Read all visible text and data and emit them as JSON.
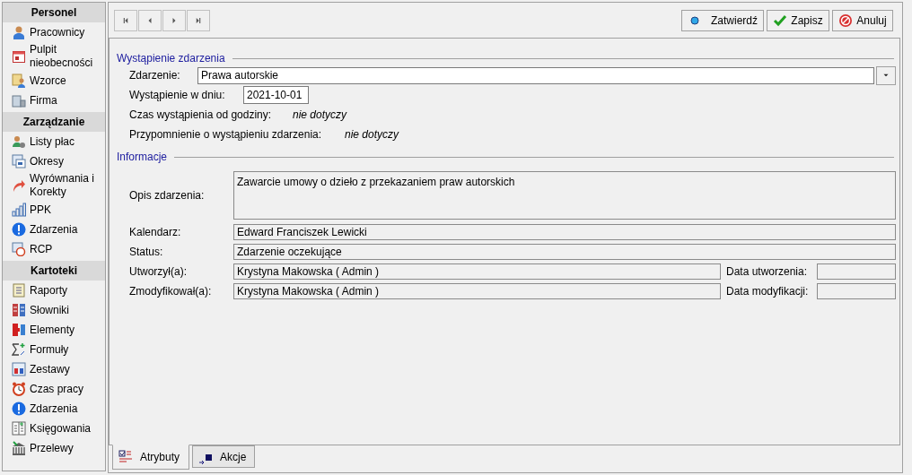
{
  "sidebar": {
    "sections": [
      {
        "title": "Personel",
        "items": [
          {
            "label": "Pracownicy"
          },
          {
            "label": "Pulpit nieobecności"
          },
          {
            "label": "Wzorce"
          },
          {
            "label": "Firma"
          }
        ]
      },
      {
        "title": "Zarządzanie",
        "items": [
          {
            "label": "Listy płac"
          },
          {
            "label": "Okresy"
          },
          {
            "label": "Wyrównania i Korekty"
          },
          {
            "label": "PPK"
          },
          {
            "label": "Zdarzenia"
          },
          {
            "label": "RCP"
          }
        ]
      },
      {
        "title": "Kartoteki",
        "items": [
          {
            "label": "Raporty"
          },
          {
            "label": "Słowniki"
          },
          {
            "label": "Elementy"
          },
          {
            "label": "Formuły"
          },
          {
            "label": "Zestawy"
          },
          {
            "label": "Czas pracy"
          },
          {
            "label": "Zdarzenia"
          },
          {
            "label": "Księgowania"
          },
          {
            "label": "Przelewy"
          }
        ]
      }
    ]
  },
  "toolbar": {
    "buttons": [
      {
        "label": "Zatwierdź"
      },
      {
        "label": "Zapisz"
      },
      {
        "label": "Anuluj"
      }
    ]
  },
  "occurrence": {
    "heading": "Wystąpienie zdarzenia",
    "event_label": "Zdarzenie:",
    "event_value": "Prawa autorskie",
    "date_label": "Wystąpienie w dniu:",
    "date_value": "2021-10-01",
    "time_label": "Czas wystąpienia od godziny:",
    "time_value": "nie dotyczy",
    "reminder_label": "Przypomnienie o wystąpieniu zdarzenia:",
    "reminder_value": "nie dotyczy"
  },
  "info": {
    "heading": "Informacje",
    "description_label": "Opis zdarzenia:",
    "description_value": "Zawarcie umowy o dzieło z przekazaniem praw autorskich",
    "calendar_label": "Kalendarz:",
    "calendar_value": "Edward Franciszek Lewicki",
    "status_label": "Status:",
    "status_value": "Zdarzenie oczekujące",
    "created_by_label": "Utworzył(a):",
    "created_by_value": "Krystyna Makowska ( Admin )",
    "created_date_label": "Data utworzenia:",
    "modified_by_label": "Zmodyfikował(a):",
    "modified_by_value": "Krystyna Makowska ( Admin )",
    "modified_date_label": "Data modyfikacji:"
  },
  "tabs": [
    {
      "label": "Atrybuty",
      "selected": true
    },
    {
      "label": "Akcje",
      "selected": false
    }
  ]
}
